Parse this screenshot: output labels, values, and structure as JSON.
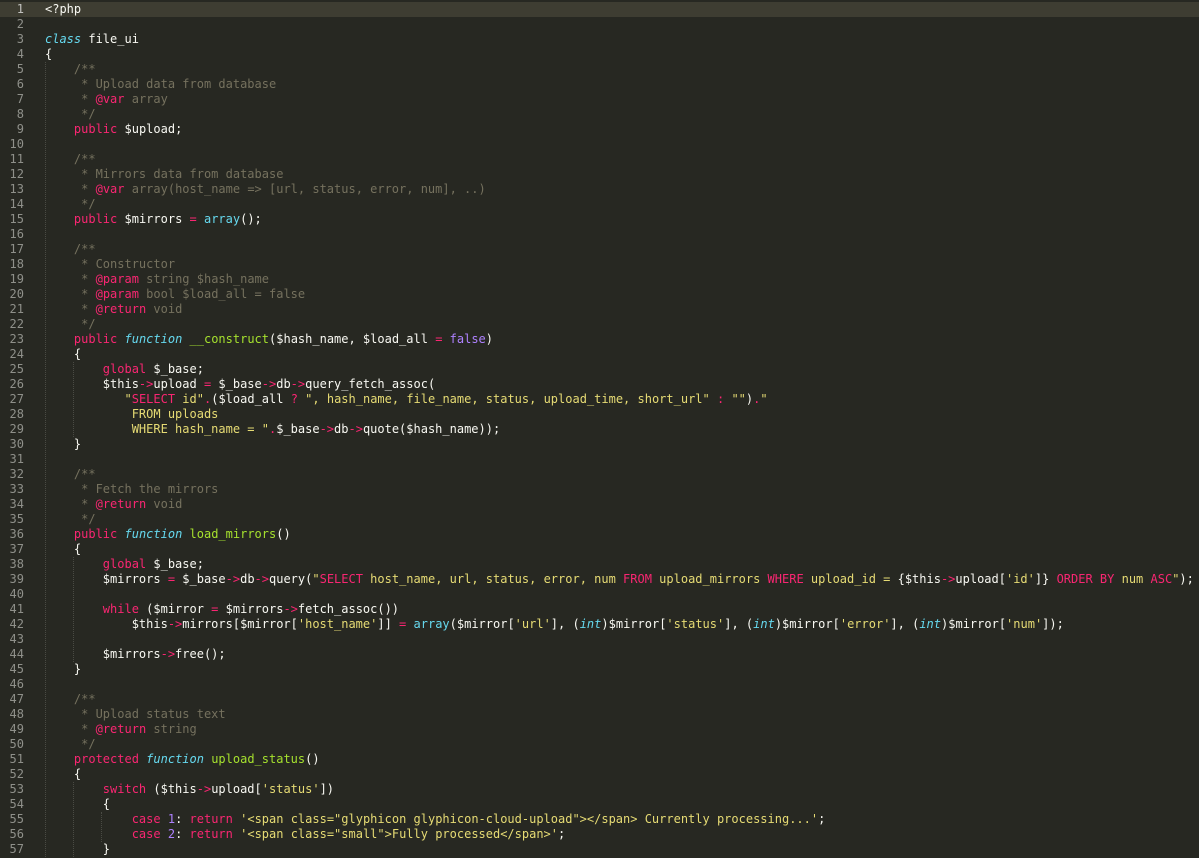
{
  "editor": {
    "language": "php",
    "current_line": 1,
    "theme_colors": {
      "background": "#272822",
      "current_line": "#3e3d32",
      "line_number": "#8f908a",
      "comment": "#75715e",
      "keyword": "#f92672",
      "string": "#e6db74",
      "function": "#a6e22e",
      "builtin": "#66d9ef",
      "number": "#ae81ff",
      "default": "#f8f8f2"
    }
  },
  "lines": [
    {
      "n": "1",
      "tokens": [
        [
          "d",
          "<?php"
        ]
      ]
    },
    {
      "n": "2",
      "tokens": []
    },
    {
      "n": "3",
      "tokens": [
        [
          "kit",
          "class"
        ],
        [
          "d",
          " file_ui"
        ]
      ]
    },
    {
      "n": "4",
      "tokens": [
        [
          "d",
          "{"
        ]
      ]
    },
    {
      "n": "5",
      "tokens": [
        [
          "d",
          "    "
        ],
        [
          "c",
          "/**"
        ]
      ]
    },
    {
      "n": "6",
      "tokens": [
        [
          "d",
          "    "
        ],
        [
          "c",
          " * Upload data from database"
        ]
      ]
    },
    {
      "n": "7",
      "tokens": [
        [
          "d",
          "    "
        ],
        [
          "c",
          " * "
        ],
        [
          "k",
          "@var"
        ],
        [
          "c",
          " array"
        ]
      ]
    },
    {
      "n": "8",
      "tokens": [
        [
          "d",
          "    "
        ],
        [
          "c",
          " */"
        ]
      ]
    },
    {
      "n": "9",
      "tokens": [
        [
          "d",
          "    "
        ],
        [
          "k",
          "public"
        ],
        [
          "d",
          " $upload;"
        ]
      ]
    },
    {
      "n": "10",
      "tokens": []
    },
    {
      "n": "11",
      "tokens": [
        [
          "d",
          "    "
        ],
        [
          "c",
          "/**"
        ]
      ]
    },
    {
      "n": "12",
      "tokens": [
        [
          "d",
          "    "
        ],
        [
          "c",
          " * Mirrors data from database"
        ]
      ]
    },
    {
      "n": "13",
      "tokens": [
        [
          "d",
          "    "
        ],
        [
          "c",
          " * "
        ],
        [
          "k",
          "@var"
        ],
        [
          "c",
          " array(host_name => [url, status, error, num], ..)"
        ]
      ]
    },
    {
      "n": "14",
      "tokens": [
        [
          "d",
          "    "
        ],
        [
          "c",
          " */"
        ]
      ]
    },
    {
      "n": "15",
      "tokens": [
        [
          "d",
          "    "
        ],
        [
          "k",
          "public"
        ],
        [
          "d",
          " $mirrors "
        ],
        [
          "k",
          "="
        ],
        [
          "d",
          " "
        ],
        [
          "b",
          "array"
        ],
        [
          "d",
          "();"
        ]
      ]
    },
    {
      "n": "16",
      "tokens": []
    },
    {
      "n": "17",
      "tokens": [
        [
          "d",
          "    "
        ],
        [
          "c",
          "/**"
        ]
      ]
    },
    {
      "n": "18",
      "tokens": [
        [
          "d",
          "    "
        ],
        [
          "c",
          " * Constructor"
        ]
      ]
    },
    {
      "n": "19",
      "tokens": [
        [
          "d",
          "    "
        ],
        [
          "c",
          " * "
        ],
        [
          "k",
          "@param"
        ],
        [
          "c",
          " string $hash_name"
        ]
      ]
    },
    {
      "n": "20",
      "tokens": [
        [
          "d",
          "    "
        ],
        [
          "c",
          " * "
        ],
        [
          "k",
          "@param"
        ],
        [
          "c",
          " bool $load_all = false"
        ]
      ]
    },
    {
      "n": "21",
      "tokens": [
        [
          "d",
          "    "
        ],
        [
          "c",
          " * "
        ],
        [
          "k",
          "@return"
        ],
        [
          "c",
          " void"
        ]
      ]
    },
    {
      "n": "22",
      "tokens": [
        [
          "d",
          "    "
        ],
        [
          "c",
          " */"
        ]
      ]
    },
    {
      "n": "23",
      "tokens": [
        [
          "d",
          "    "
        ],
        [
          "k",
          "public"
        ],
        [
          "d",
          " "
        ],
        [
          "kit",
          "function"
        ],
        [
          "d",
          " "
        ],
        [
          "f",
          "__construct"
        ],
        [
          "d",
          "($hash_name, $load_all "
        ],
        [
          "k",
          "="
        ],
        [
          "d",
          " "
        ],
        [
          "n",
          "false"
        ],
        [
          "d",
          ")"
        ]
      ]
    },
    {
      "n": "24",
      "tokens": [
        [
          "d",
          "    {"
        ]
      ]
    },
    {
      "n": "25",
      "tokens": [
        [
          "d",
          "        "
        ],
        [
          "k",
          "global"
        ],
        [
          "d",
          " $_base;"
        ]
      ]
    },
    {
      "n": "26",
      "tokens": [
        [
          "d",
          "        $this"
        ],
        [
          "k",
          "->"
        ],
        [
          "d",
          "upload "
        ],
        [
          "k",
          "="
        ],
        [
          "d",
          " $_base"
        ],
        [
          "k",
          "->"
        ],
        [
          "d",
          "db"
        ],
        [
          "k",
          "->"
        ],
        [
          "d",
          "query_fetch_assoc("
        ]
      ]
    },
    {
      "n": "27",
      "tokens": [
        [
          "d",
          "           "
        ],
        [
          "s",
          "\""
        ],
        [
          "k",
          "SELECT"
        ],
        [
          "s",
          " id\""
        ],
        [
          "k",
          "."
        ],
        [
          "d",
          "($load_all "
        ],
        [
          "k",
          "?"
        ],
        [
          "d",
          " "
        ],
        [
          "s",
          "\", hash_name, file_name, status, upload_time, short_url\""
        ],
        [
          "d",
          " "
        ],
        [
          "k",
          ":"
        ],
        [
          "d",
          " "
        ],
        [
          "s",
          "\"\""
        ],
        [
          "d",
          ")"
        ],
        [
          "k",
          "."
        ],
        [
          "s",
          "\""
        ]
      ]
    },
    {
      "n": "28",
      "tokens": [
        [
          "d",
          "            "
        ],
        [
          "s",
          "FROM uploads"
        ]
      ]
    },
    {
      "n": "29",
      "tokens": [
        [
          "d",
          "            "
        ],
        [
          "s",
          "WHERE hash_name = \""
        ],
        [
          "k",
          "."
        ],
        [
          "d",
          "$_base"
        ],
        [
          "k",
          "->"
        ],
        [
          "d",
          "db"
        ],
        [
          "k",
          "->"
        ],
        [
          "d",
          "quote($hash_name));"
        ]
      ]
    },
    {
      "n": "30",
      "tokens": [
        [
          "d",
          "    }"
        ]
      ]
    },
    {
      "n": "31",
      "tokens": []
    },
    {
      "n": "32",
      "tokens": [
        [
          "d",
          "    "
        ],
        [
          "c",
          "/**"
        ]
      ]
    },
    {
      "n": "33",
      "tokens": [
        [
          "d",
          "    "
        ],
        [
          "c",
          " * Fetch the mirrors"
        ]
      ]
    },
    {
      "n": "34",
      "tokens": [
        [
          "d",
          "    "
        ],
        [
          "c",
          " * "
        ],
        [
          "k",
          "@return"
        ],
        [
          "c",
          " void"
        ]
      ]
    },
    {
      "n": "35",
      "tokens": [
        [
          "d",
          "    "
        ],
        [
          "c",
          " */"
        ]
      ]
    },
    {
      "n": "36",
      "tokens": [
        [
          "d",
          "    "
        ],
        [
          "k",
          "public"
        ],
        [
          "d",
          " "
        ],
        [
          "kit",
          "function"
        ],
        [
          "d",
          " "
        ],
        [
          "f",
          "load_mirrors"
        ],
        [
          "d",
          "()"
        ]
      ]
    },
    {
      "n": "37",
      "tokens": [
        [
          "d",
          "    {"
        ]
      ]
    },
    {
      "n": "38",
      "tokens": [
        [
          "d",
          "        "
        ],
        [
          "k",
          "global"
        ],
        [
          "d",
          " $_base;"
        ]
      ]
    },
    {
      "n": "39",
      "tokens": [
        [
          "d",
          "        $mirrors "
        ],
        [
          "k",
          "="
        ],
        [
          "d",
          " $_base"
        ],
        [
          "k",
          "->"
        ],
        [
          "d",
          "db"
        ],
        [
          "k",
          "->"
        ],
        [
          "d",
          "query("
        ],
        [
          "s",
          "\""
        ],
        [
          "k",
          "SELECT"
        ],
        [
          "s",
          " host_name, url, status, error, num "
        ],
        [
          "k",
          "FROM"
        ],
        [
          "s",
          " upload_mirrors "
        ],
        [
          "k",
          "WHERE"
        ],
        [
          "s",
          " upload_id = "
        ],
        [
          "d",
          "{$this"
        ],
        [
          "k",
          "->"
        ],
        [
          "d",
          "upload["
        ],
        [
          "s",
          "'id'"
        ],
        [
          "d",
          "]}"
        ],
        [
          "s",
          " "
        ],
        [
          "k",
          "ORDER BY"
        ],
        [
          "s",
          " num "
        ],
        [
          "k",
          "ASC"
        ],
        [
          "s",
          "\""
        ],
        [
          "d",
          ");"
        ]
      ]
    },
    {
      "n": "40",
      "tokens": []
    },
    {
      "n": "41",
      "tokens": [
        [
          "d",
          "        "
        ],
        [
          "k",
          "while"
        ],
        [
          "d",
          " ($mirror "
        ],
        [
          "k",
          "="
        ],
        [
          "d",
          " $mirrors"
        ],
        [
          "k",
          "->"
        ],
        [
          "d",
          "fetch_assoc())"
        ]
      ]
    },
    {
      "n": "42",
      "tokens": [
        [
          "d",
          "            $this"
        ],
        [
          "k",
          "->"
        ],
        [
          "d",
          "mirrors[$mirror["
        ],
        [
          "s",
          "'host_name'"
        ],
        [
          "d",
          "]] "
        ],
        [
          "k",
          "="
        ],
        [
          "d",
          " "
        ],
        [
          "b",
          "array"
        ],
        [
          "d",
          "($mirror["
        ],
        [
          "s",
          "'url'"
        ],
        [
          "d",
          "], ("
        ],
        [
          "kit",
          "int"
        ],
        [
          "d",
          ")$mirror["
        ],
        [
          "s",
          "'status'"
        ],
        [
          "d",
          "], ("
        ],
        [
          "kit",
          "int"
        ],
        [
          "d",
          ")$mirror["
        ],
        [
          "s",
          "'error'"
        ],
        [
          "d",
          "], ("
        ],
        [
          "kit",
          "int"
        ],
        [
          "d",
          ")$mirror["
        ],
        [
          "s",
          "'num'"
        ],
        [
          "d",
          "]);"
        ]
      ]
    },
    {
      "n": "43",
      "tokens": []
    },
    {
      "n": "44",
      "tokens": [
        [
          "d",
          "        $mirrors"
        ],
        [
          "k",
          "->"
        ],
        [
          "d",
          "free();"
        ]
      ]
    },
    {
      "n": "45",
      "tokens": [
        [
          "d",
          "    }"
        ]
      ]
    },
    {
      "n": "46",
      "tokens": []
    },
    {
      "n": "47",
      "tokens": [
        [
          "d",
          "    "
        ],
        [
          "c",
          "/**"
        ]
      ]
    },
    {
      "n": "48",
      "tokens": [
        [
          "d",
          "    "
        ],
        [
          "c",
          " * Upload status text"
        ]
      ]
    },
    {
      "n": "49",
      "tokens": [
        [
          "d",
          "    "
        ],
        [
          "c",
          " * "
        ],
        [
          "k",
          "@return"
        ],
        [
          "c",
          " string"
        ]
      ]
    },
    {
      "n": "50",
      "tokens": [
        [
          "d",
          "    "
        ],
        [
          "c",
          " */"
        ]
      ]
    },
    {
      "n": "51",
      "tokens": [
        [
          "d",
          "    "
        ],
        [
          "k",
          "protected"
        ],
        [
          "d",
          " "
        ],
        [
          "kit",
          "function"
        ],
        [
          "d",
          " "
        ],
        [
          "f",
          "upload_status"
        ],
        [
          "d",
          "()"
        ]
      ]
    },
    {
      "n": "52",
      "tokens": [
        [
          "d",
          "    {"
        ]
      ]
    },
    {
      "n": "53",
      "tokens": [
        [
          "d",
          "        "
        ],
        [
          "k",
          "switch"
        ],
        [
          "d",
          " ($this"
        ],
        [
          "k",
          "->"
        ],
        [
          "d",
          "upload["
        ],
        [
          "s",
          "'status'"
        ],
        [
          "d",
          "])"
        ]
      ]
    },
    {
      "n": "54",
      "tokens": [
        [
          "d",
          "        {"
        ]
      ]
    },
    {
      "n": "55",
      "tokens": [
        [
          "d",
          "            "
        ],
        [
          "k",
          "case"
        ],
        [
          "d",
          " "
        ],
        [
          "n",
          "1"
        ],
        [
          "d",
          ": "
        ],
        [
          "k",
          "return"
        ],
        [
          "d",
          " "
        ],
        [
          "s",
          "'<span class=\"glyphicon glyphicon-cloud-upload\"></span> Currently processing...'"
        ],
        [
          "d",
          ";"
        ]
      ]
    },
    {
      "n": "56",
      "tokens": [
        [
          "d",
          "            "
        ],
        [
          "k",
          "case"
        ],
        [
          "d",
          " "
        ],
        [
          "n",
          "2"
        ],
        [
          "d",
          ": "
        ],
        [
          "k",
          "return"
        ],
        [
          "d",
          " "
        ],
        [
          "s",
          "'<span class=\"small\">Fully processed</span>'"
        ],
        [
          "d",
          ";"
        ]
      ]
    },
    {
      "n": "57",
      "tokens": [
        [
          "d",
          "        }"
        ]
      ]
    }
  ]
}
